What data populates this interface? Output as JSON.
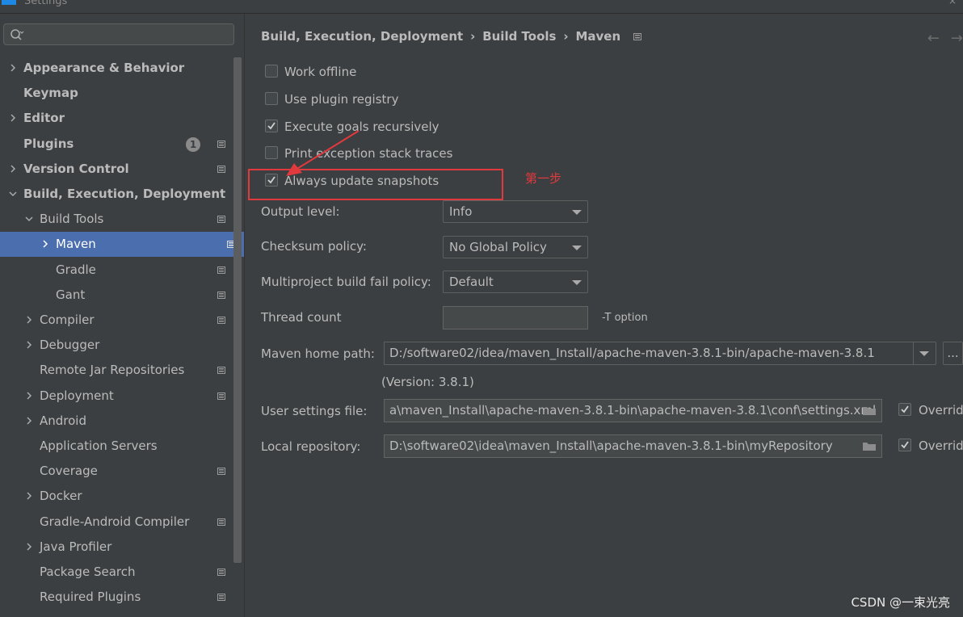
{
  "window": {
    "title": "Settings",
    "close_glyph": "×"
  },
  "search": {
    "placeholder": ""
  },
  "sidebar": {
    "items": [
      {
        "label": "Appearance & Behavior",
        "level": 0,
        "chevron": "right",
        "bold": true,
        "icon": false
      },
      {
        "label": "Keymap",
        "level": 0,
        "chevron": "none",
        "bold": true,
        "icon": false
      },
      {
        "label": "Editor",
        "level": 0,
        "chevron": "right",
        "bold": true,
        "icon": false
      },
      {
        "label": "Plugins",
        "level": 0,
        "chevron": "none",
        "bold": true,
        "icon": true,
        "badge": "1"
      },
      {
        "label": "Version Control",
        "level": 0,
        "chevron": "right",
        "bold": true,
        "icon": true
      },
      {
        "label": "Build, Execution, Deployment",
        "level": 0,
        "chevron": "down",
        "bold": true,
        "icon": false
      },
      {
        "label": "Build Tools",
        "level": 1,
        "chevron": "down",
        "bold": false,
        "icon": true
      },
      {
        "label": "Maven",
        "level": 2,
        "chevron": "right",
        "bold": false,
        "icon": true,
        "selected": true
      },
      {
        "label": "Gradle",
        "level": 2,
        "chevron": "none",
        "bold": false,
        "icon": true
      },
      {
        "label": "Gant",
        "level": 2,
        "chevron": "none",
        "bold": false,
        "icon": true
      },
      {
        "label": "Compiler",
        "level": 1,
        "chevron": "right",
        "bold": false,
        "icon": true
      },
      {
        "label": "Debugger",
        "level": 1,
        "chevron": "right",
        "bold": false,
        "icon": false
      },
      {
        "label": "Remote Jar Repositories",
        "level": 1,
        "chevron": "none",
        "bold": false,
        "icon": true
      },
      {
        "label": "Deployment",
        "level": 1,
        "chevron": "right",
        "bold": false,
        "icon": true
      },
      {
        "label": "Android",
        "level": 1,
        "chevron": "right",
        "bold": false,
        "icon": false
      },
      {
        "label": "Application Servers",
        "level": 1,
        "chevron": "none",
        "bold": false,
        "icon": false
      },
      {
        "label": "Coverage",
        "level": 1,
        "chevron": "none",
        "bold": false,
        "icon": true
      },
      {
        "label": "Docker",
        "level": 1,
        "chevron": "right",
        "bold": false,
        "icon": false
      },
      {
        "label": "Gradle-Android Compiler",
        "level": 1,
        "chevron": "none",
        "bold": false,
        "icon": true
      },
      {
        "label": "Java Profiler",
        "level": 1,
        "chevron": "right",
        "bold": false,
        "icon": false
      },
      {
        "label": "Package Search",
        "level": 1,
        "chevron": "none",
        "bold": false,
        "icon": true
      },
      {
        "label": "Required Plugins",
        "level": 1,
        "chevron": "none",
        "bold": false,
        "icon": true
      }
    ]
  },
  "breadcrumb": {
    "part1": "Build, Execution, Deployment",
    "part2": "Build Tools",
    "part3": "Maven",
    "separator": "›"
  },
  "nav": {
    "back": "←",
    "forward": "→"
  },
  "options": {
    "work_offline": {
      "label": "Work offline",
      "checked": false
    },
    "plugin_registry": {
      "label": "Use plugin registry",
      "checked": false
    },
    "goals_recursive": {
      "label": "Execute goals recursively",
      "checked": true
    },
    "exception_traces": {
      "label": "Print exception stack traces",
      "checked": false
    },
    "update_snapshots": {
      "label": "Always update snapshots",
      "checked": true
    }
  },
  "fields": {
    "output_level": {
      "label": "Output level:",
      "value": "Info"
    },
    "checksum_policy": {
      "label": "Checksum policy:",
      "value": "No Global Policy"
    },
    "fail_policy": {
      "label": "Multiproject build fail policy:",
      "value": "Default"
    },
    "thread_count": {
      "label": "Thread count",
      "value": "",
      "hint": "-T option"
    },
    "maven_home": {
      "label": "Maven home path:",
      "value": "D:/software02/idea/maven_Install/apache-maven-3.8.1-bin/apache-maven-3.8.1",
      "version": "(Version: 3.8.1)",
      "browse": "..."
    },
    "user_settings": {
      "label": "User settings file:",
      "value": "a\\maven_Install\\apache-maven-3.8.1-bin\\apache-maven-3.8.1\\conf\\settings.xml",
      "override": "Overrid",
      "override_checked": true
    },
    "local_repo": {
      "label": "Local repository:",
      "value": "D:\\software02\\idea\\maven_Install\\apache-maven-3.8.1-bin\\myRepository",
      "override": "Overrid",
      "override_checked": true
    }
  },
  "annotation": {
    "text": "第一步",
    "color": "#e0393e"
  },
  "watermark": "CSDN @一束光亮",
  "colors": {
    "background": "#3c3f41",
    "selection": "#4b6eaf",
    "text": "#bbbbbb"
  }
}
